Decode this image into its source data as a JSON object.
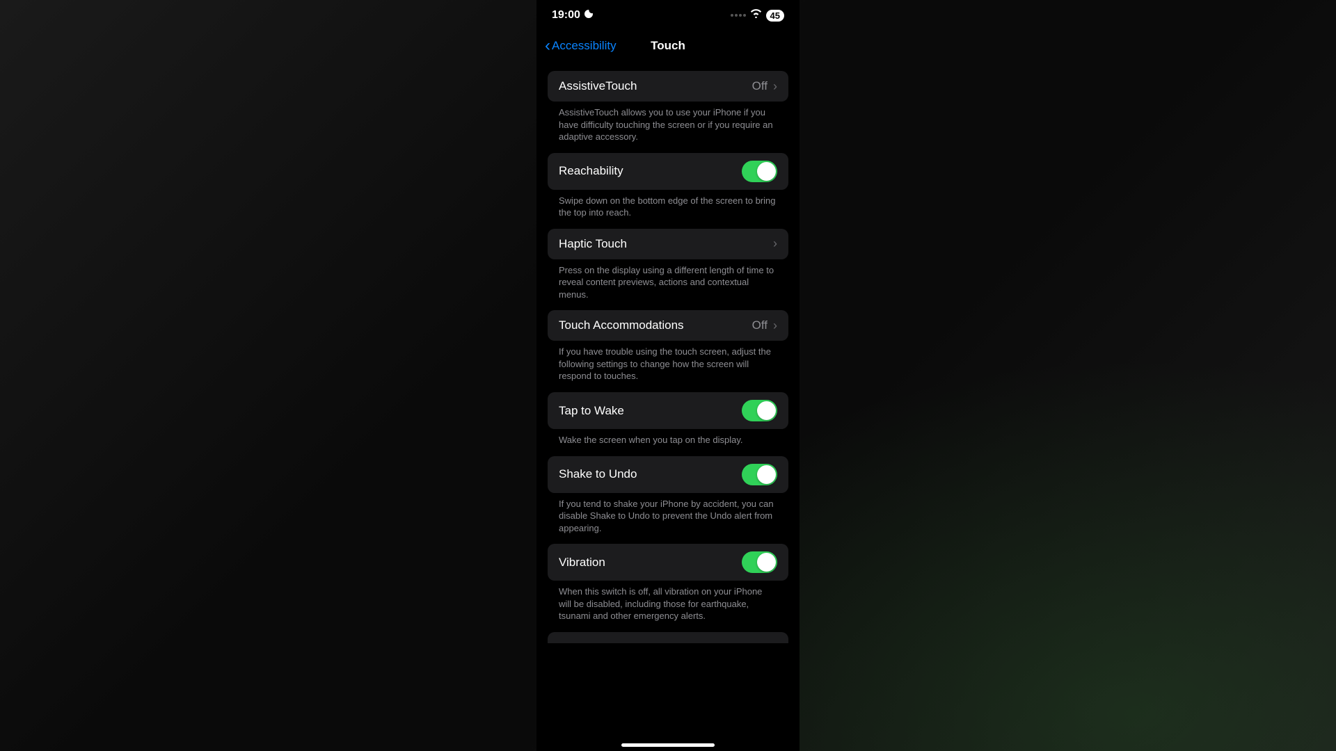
{
  "statusbar": {
    "time": "19:00",
    "battery": "45"
  },
  "nav": {
    "back": "Accessibility",
    "title": "Touch"
  },
  "rows": {
    "assistive": {
      "label": "AssistiveTouch",
      "value": "Off",
      "footer": "AssistiveTouch allows you to use your iPhone if you have difficulty touching the screen or if you require an adaptive accessory."
    },
    "reachability": {
      "label": "Reachability",
      "footer": "Swipe down on the bottom edge of the screen to bring the top into reach."
    },
    "haptic": {
      "label": "Haptic Touch",
      "footer": "Press on the display using a different length of time to reveal content previews, actions and contextual menus."
    },
    "accommodations": {
      "label": "Touch Accommodations",
      "value": "Off",
      "footer": "If you have trouble using the touch screen, adjust the following settings to change how the screen will respond to touches."
    },
    "taptowake": {
      "label": "Tap to Wake",
      "footer": "Wake the screen when you tap on the display."
    },
    "shake": {
      "label": "Shake to Undo",
      "footer": "If you tend to shake your iPhone by accident, you can disable Shake to Undo to prevent the Undo alert from appearing."
    },
    "vibration": {
      "label": "Vibration",
      "footer": "When this switch is off, all vibration on your iPhone will be disabled, including those for earthquake, tsunami and other emergency alerts."
    }
  }
}
